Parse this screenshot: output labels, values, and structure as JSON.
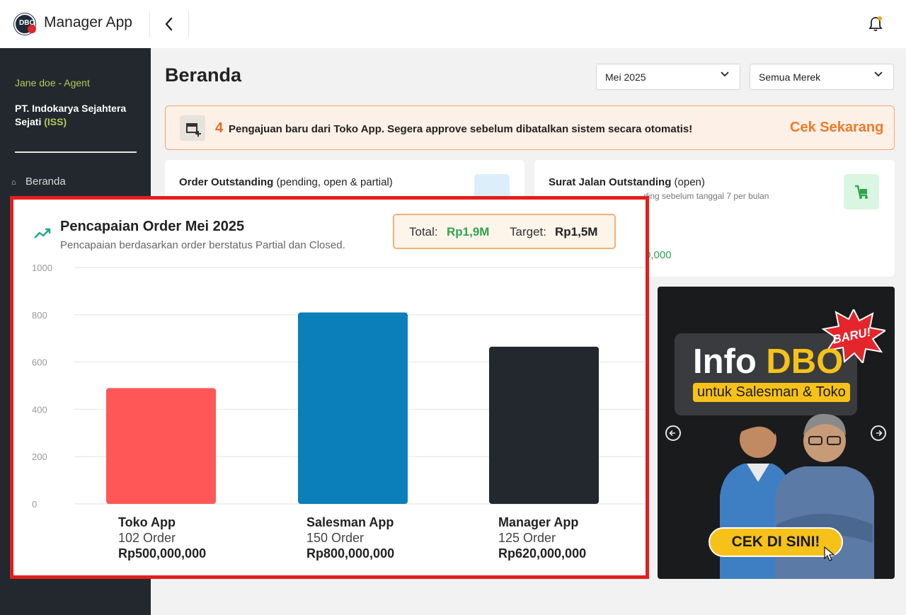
{
  "app": {
    "logo_text": "DBO",
    "title": "Manager App",
    "back_glyph": "‹",
    "bell_icon": "bell-icon"
  },
  "sidebar": {
    "agent": "Jane doe - Agent",
    "company_name": "PT. Indokarya Sejahtera Sejati",
    "company_code": "(ISS)",
    "items": [
      {
        "label": "Beranda",
        "icon": "home-icon"
      }
    ]
  },
  "page": {
    "title": "Beranda",
    "filters": {
      "month": "Mei 2025",
      "brand": "Semua Merek"
    }
  },
  "banner": {
    "count": "4",
    "text": "Pengajuan baru dari Toko App. Segera approve sebelum dibatalkan sistem secara otomatis!",
    "action": "Cek Sekarang"
  },
  "cards": [
    {
      "title_bold": "Order Outstanding",
      "title_rest": "(pending, open & partial)",
      "subtitle": "",
      "icon": "document-icon",
      "icon_color": "#dbeefa"
    },
    {
      "title_bold": "Surat Jalan Outstanding",
      "title_rest": "(open)",
      "subtitle": "ding sebelum tanggal 7 per bulan",
      "value": "0,000",
      "icon": "cart-icon",
      "icon_color": "#daf5e1"
    }
  ],
  "promo": {
    "title_a": "Info ",
    "title_b": "DBO",
    "subtitle": "untuk Salesman & Toko",
    "badge": "BARU!",
    "cta": "CEK DI SINI!"
  },
  "chart_panel": {
    "title": "Pencapaian Order Mei 2025",
    "subtitle": "Pencapaian berdasarkan order berstatus Partial dan Closed.",
    "total_label": "Total:",
    "total_value": "Rp1,9M",
    "target_label": "Target:",
    "target_value": "Rp1,5M",
    "categories_detail": [
      {
        "name": "Toko App",
        "orders": "102 Order",
        "amount": "Rp500,000,000"
      },
      {
        "name": "Salesman App",
        "orders": "150 Order",
        "amount": "Rp800,000,000"
      },
      {
        "name": "Manager App",
        "orders": "125 Order",
        "amount": "Rp620,000,000"
      }
    ]
  },
  "colors": {
    "accent": "#ef7a2a",
    "success": "#2ea44f",
    "highlight_border": "#e41e1e",
    "sidebar_bg": "#22282e"
  },
  "chart_data": {
    "type": "bar",
    "title": "Pencapaian Order Mei 2025",
    "categories": [
      "Toko App",
      "Salesman App",
      "Manager App"
    ],
    "values": [
      490,
      810,
      665
    ],
    "colors": [
      "#ff5757",
      "#0a7fb9",
      "#22282e"
    ],
    "yticks": [
      0,
      200,
      400,
      600,
      800,
      1000
    ],
    "ylim": [
      0,
      1000
    ],
    "grid": true
  }
}
